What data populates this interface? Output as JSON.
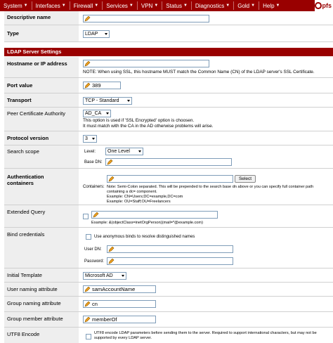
{
  "nav": {
    "items": [
      {
        "label": "System"
      },
      {
        "label": "Interfaces"
      },
      {
        "label": "Firewall"
      },
      {
        "label": "Services"
      },
      {
        "label": "VPN"
      },
      {
        "label": "Status"
      },
      {
        "label": "Diagnostics"
      },
      {
        "label": "Gold"
      },
      {
        "label": "Help"
      }
    ],
    "logo_text": "pfs"
  },
  "form": {
    "descriptive_name": {
      "label": "Descriptive name",
      "value": ""
    },
    "type": {
      "label": "Type",
      "value": "LDAP"
    },
    "section_title": "LDAP Server Settings",
    "hostname": {
      "label": "Hostname or IP address",
      "value": "",
      "note": "NOTE: When using SSL, this hostname MUST match the Common Name (CN) of the LDAP server's SSL Certificate."
    },
    "port": {
      "label": "Port value",
      "value": "389"
    },
    "transport": {
      "label": "Transport",
      "value": "TCP - Standard"
    },
    "peer_ca": {
      "label": "Peer Certificate Authority",
      "value": "AD_CA",
      "note1": "This option is used if 'SSL Encrypted' option is choosen.",
      "note2": "It must match with the CA in the AD otherwise problems will arise."
    },
    "protocol_version": {
      "label": "Protocol version",
      "value": "3"
    },
    "search_scope": {
      "label": "Search scope",
      "level_label": "Level:",
      "level_value": "One Level",
      "base_dn_label": "Base DN:",
      "base_dn_value": ""
    },
    "auth_containers": {
      "label": "Authentication containers",
      "value": "",
      "select_button": "Select",
      "containers_label": "Containers:",
      "note1": "Note: Semi-Colon separated. This will be prepended to the search base dn above or you can specify full container path",
      "note2": "containing a dc= component.",
      "note3": "Example: CN=Users;DC=example,DC=com",
      "note4": "Example: OU=Staff;OU=Freelancers"
    },
    "extended_query": {
      "label": "Extended Query",
      "value": "",
      "example": "Example: &(objectClass=inetOrgPerson)(mail=*@example.com)"
    },
    "bind_credentials": {
      "label": "Bind credentials",
      "anon_label": "Use anonymous binds to resolve distinguished names",
      "user_dn_label": "User DN:",
      "user_dn_value": "",
      "password_label": "Password:",
      "password_value": ""
    },
    "initial_template": {
      "label": "Initial Template",
      "value": "Microsoft AD"
    },
    "user_naming": {
      "label": "User naming attribute",
      "value": "samAccountName"
    },
    "group_naming": {
      "label": "Group naming attribute",
      "value": "cn"
    },
    "group_member": {
      "label": "Group member attribute",
      "value": "memberOf"
    },
    "utf8": {
      "label": "UTF8 Encode",
      "note1": "UTF8 encode LDAP parameters before sending them to the server. Required to support international characters, but may not be",
      "note2": "supported by every LDAP server."
    }
  },
  "colors": {
    "nav_bg": "#990000",
    "section_bg": "#990000",
    "label_bg": "#eeeeee"
  }
}
